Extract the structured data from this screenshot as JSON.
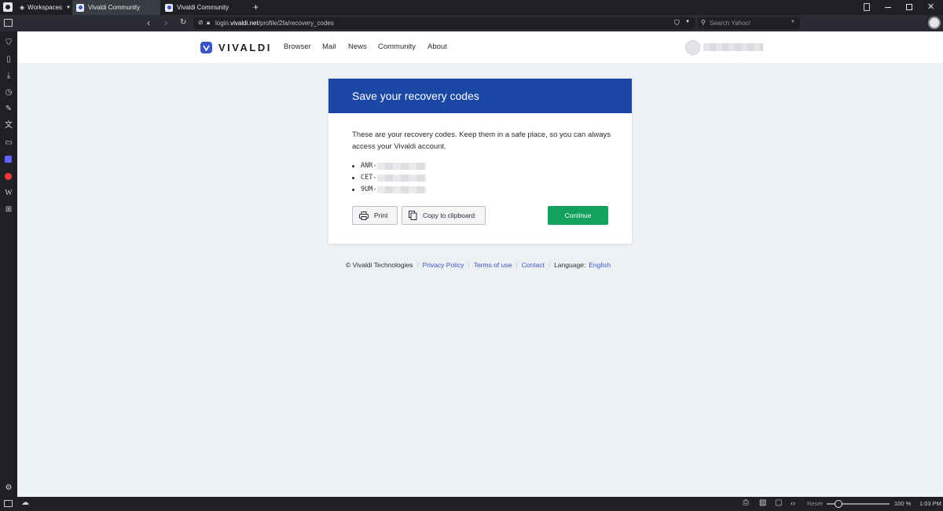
{
  "browser": {
    "workspaces_label": "Workspaces",
    "tabs": [
      {
        "title": "Vivaldi Community"
      },
      {
        "title": "Vivaldi Community"
      }
    ],
    "url_prefix": "login.",
    "url_domain": "vivaldi.net",
    "url_path": "/profile/2fa/recovery_codes",
    "search_placeholder": "Search Yahoo!",
    "status": {
      "reset_label": "Reset",
      "zoom": "100 %",
      "time": "1:03 PM"
    }
  },
  "site": {
    "logo_text": "VIVALDI",
    "nav": [
      "Browser",
      "Mail",
      "News",
      "Community",
      "About"
    ]
  },
  "card": {
    "title": "Save your recovery codes",
    "description": "These are your recovery codes. Keep them in a safe place, so you can always access your Vivaldi account.",
    "codes": [
      "ANR-",
      "CET-",
      "9UM-"
    ],
    "print_label": "Print",
    "copy_label": "Copy to clipboard",
    "continue_label": "Continue"
  },
  "footer": {
    "copyright": "© Vivaldi Technologies",
    "privacy": "Privacy Policy",
    "terms": "Terms of use",
    "contact": "Contact",
    "language_label": "Language:",
    "language": "English"
  },
  "colors": {
    "accent": "#1b48a5",
    "continue": "#12a25d",
    "link": "#3a56c4"
  }
}
